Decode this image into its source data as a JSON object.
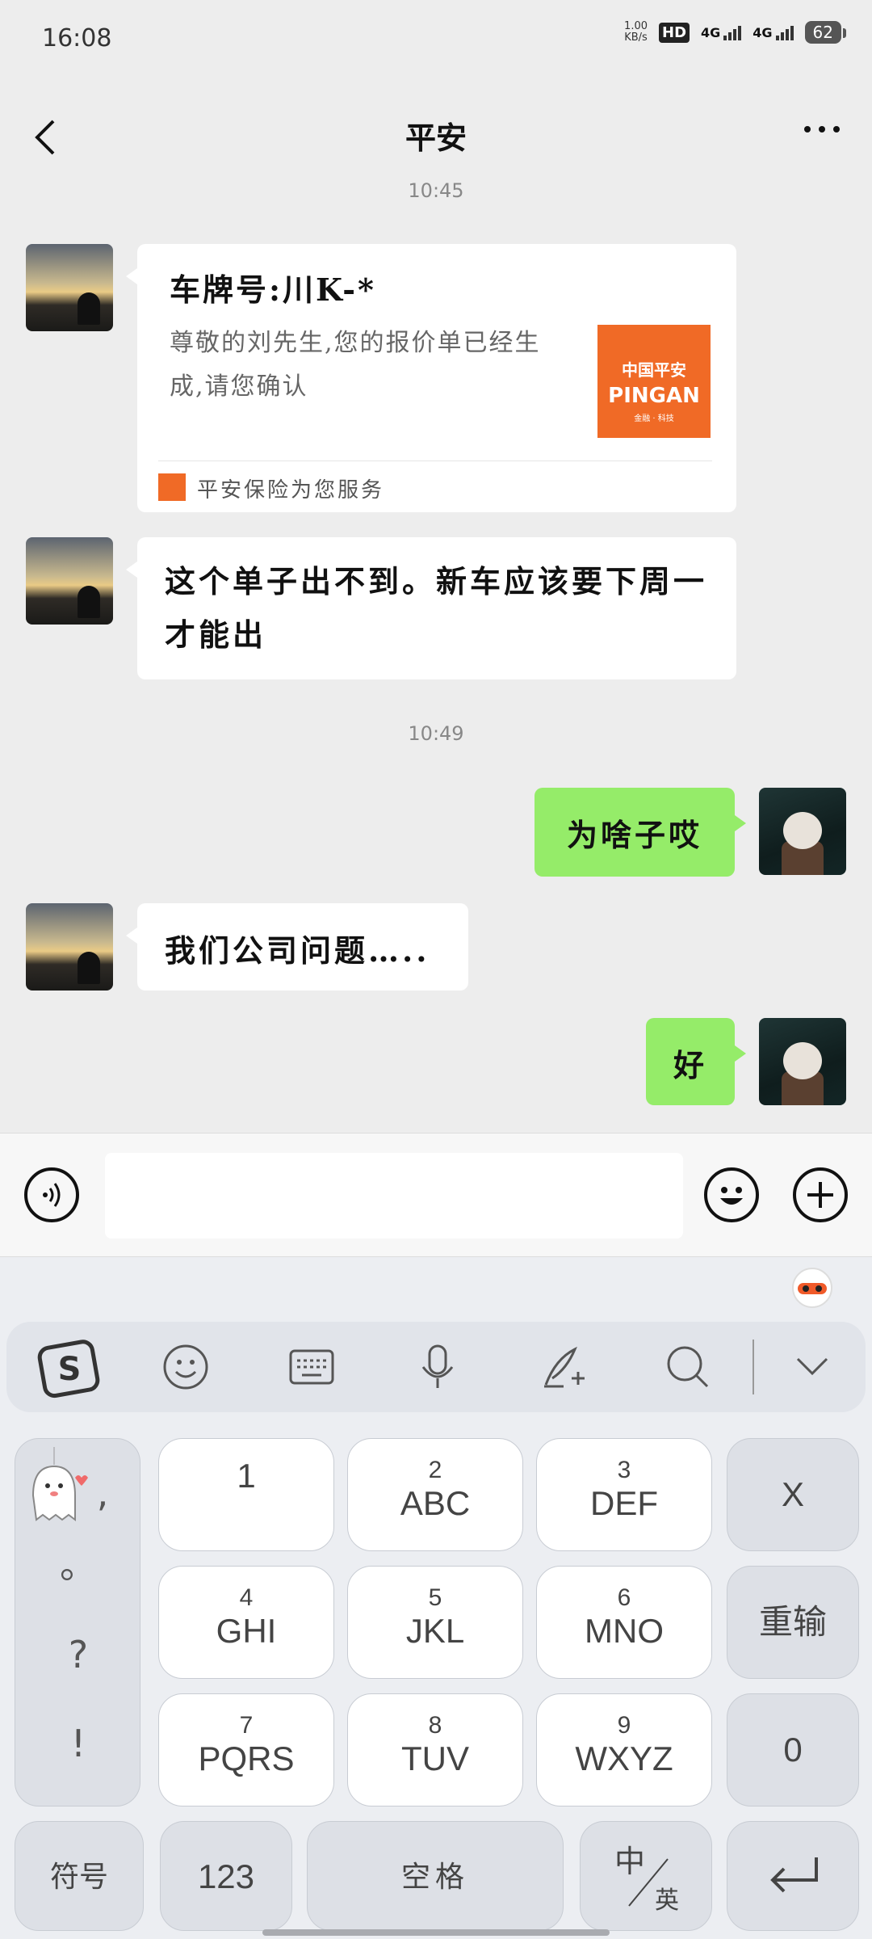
{
  "status_bar": {
    "time": "16:08",
    "speed_value": "1.00",
    "speed_unit": "KB/s",
    "hd": "HD",
    "network1": "4G",
    "network2": "4G",
    "battery": "62"
  },
  "header": {
    "title": "平安"
  },
  "messages": {
    "ts1": "10:45",
    "card": {
      "title": "车牌号:川K-*",
      "desc": "尊敬的刘先生,您的报价单已经生成,请您确认",
      "logo_line1": "中国平安",
      "logo_line2": "PINGAN",
      "logo_line3": "金融 · 科技",
      "footer": "平安保险为您服务"
    },
    "m2": "这个单子出不到。新车应该要下周一才能出",
    "ts2": "10:49",
    "m3": "为啥子哎",
    "m4": "我们公司问题…..",
    "m5": "好"
  },
  "input_bar": {
    "placeholder": ""
  },
  "keyboard": {
    "punct": [
      ",",
      "。",
      "?",
      "!"
    ],
    "k1": {
      "num": "",
      "letters": "1"
    },
    "k2": {
      "num": "2",
      "letters": "ABC"
    },
    "k3": {
      "num": "3",
      "letters": "DEF"
    },
    "k4": {
      "num": "4",
      "letters": "GHI"
    },
    "k5": {
      "num": "5",
      "letters": "JKL"
    },
    "k6": {
      "num": "6",
      "letters": "MNO"
    },
    "k7": {
      "num": "7",
      "letters": "PQRS"
    },
    "k8": {
      "num": "8",
      "letters": "TUV"
    },
    "k9": {
      "num": "9",
      "letters": "WXYZ"
    },
    "delete": "X",
    "retype": "重输",
    "zero": "0",
    "symbols": "符号",
    "numbers": "123",
    "space": "空格",
    "lang_zh": "中",
    "lang_en": "英"
  },
  "icons": [
    "back-icon",
    "more-icon",
    "voice-icon",
    "emoji-icon",
    "plus-icon",
    "sogou-icon",
    "smiley-icon",
    "keyboard-icon",
    "mic-icon",
    "handwriting-icon",
    "search-icon",
    "collapse-icon",
    "enter-icon"
  ]
}
